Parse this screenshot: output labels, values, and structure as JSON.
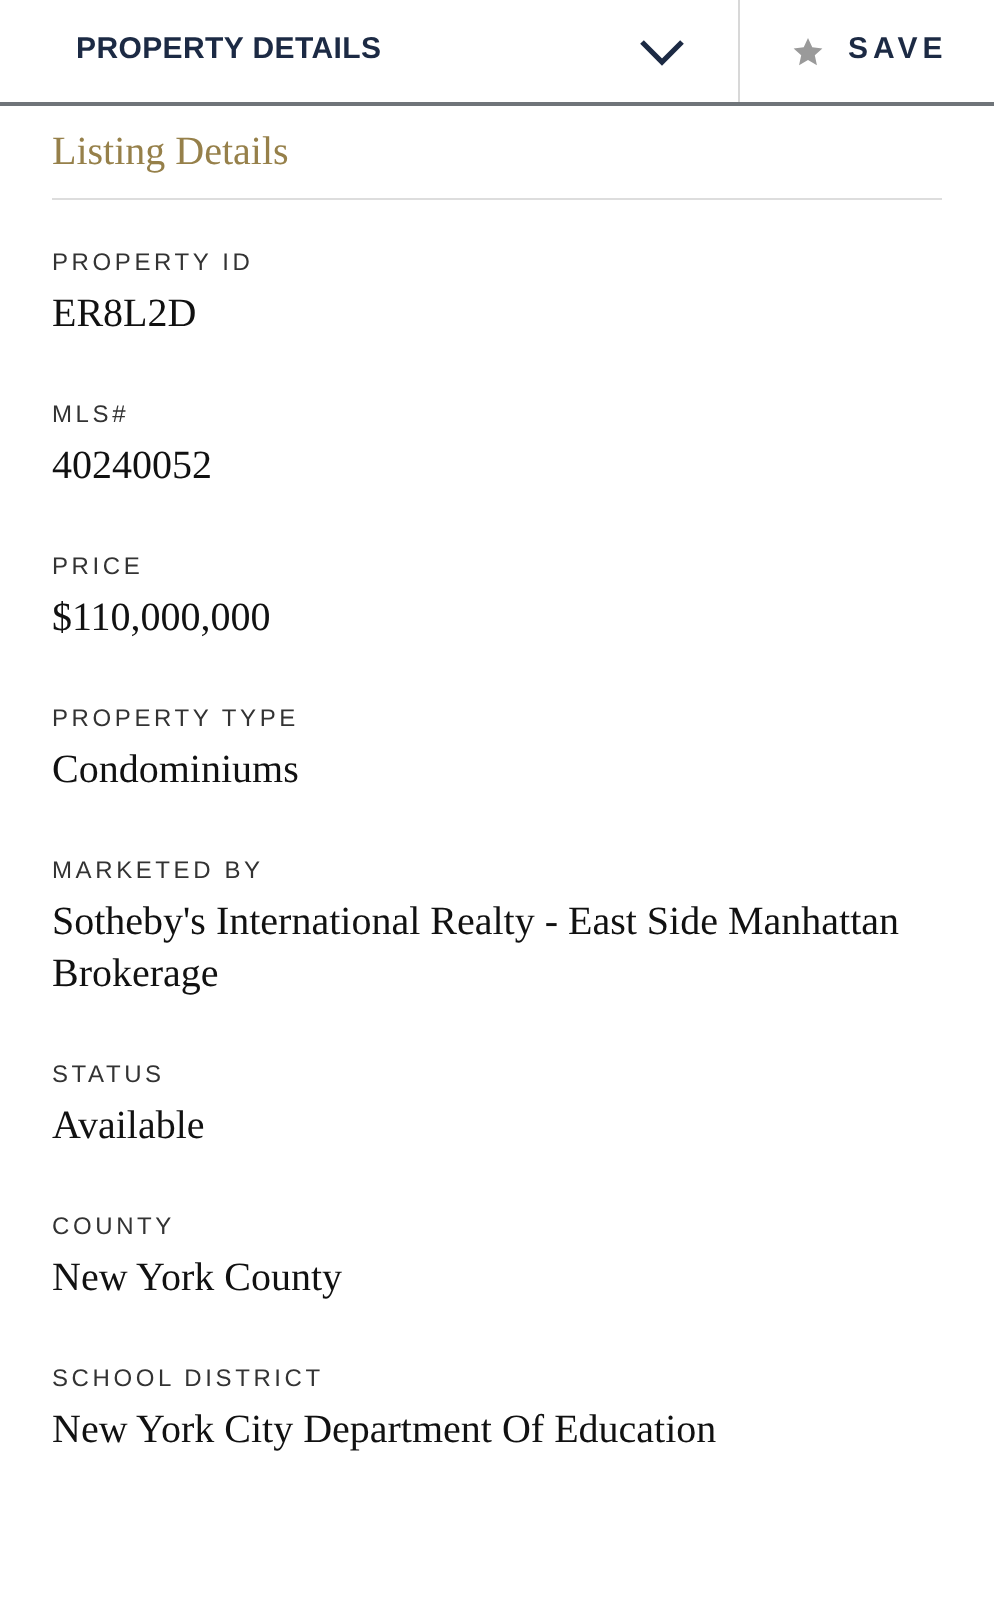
{
  "header": {
    "title": "PROPERTY DETAILS",
    "expanded": false,
    "save": {
      "label": "SAVE",
      "saved": false
    }
  },
  "section": {
    "title": "Listing Details"
  },
  "fields": [
    {
      "label": "PROPERTY ID",
      "value": "ER8L2D"
    },
    {
      "label": "MLS#",
      "value": "40240052"
    },
    {
      "label": "PRICE",
      "value": "$110,000,000"
    },
    {
      "label": "PROPERTY TYPE",
      "value": "Condominiums"
    },
    {
      "label": "MARKETED BY",
      "value": "Sotheby's International Realty - East Side Manhattan Brokerage"
    },
    {
      "label": "STATUS",
      "value": "Available"
    },
    {
      "label": "COUNTY",
      "value": "New York County"
    },
    {
      "label": "SCHOOL DISTRICT",
      "value": "New York City Department Of Education"
    }
  ]
}
